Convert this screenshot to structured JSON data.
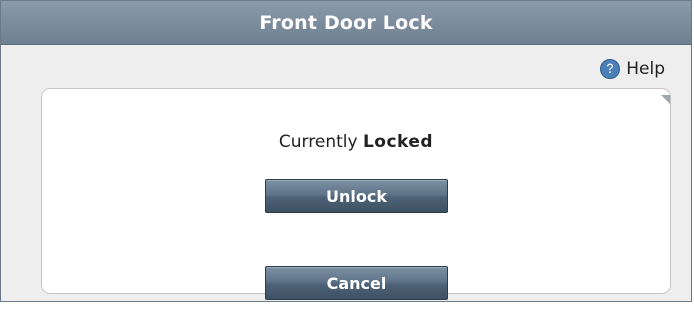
{
  "window": {
    "title": "Front Door Lock"
  },
  "help": {
    "label": "Help",
    "icon": "question-icon"
  },
  "status": {
    "prefix": "Currently",
    "state": "Locked"
  },
  "actions": {
    "unlock_label": "Unlock",
    "cancel_label": "Cancel"
  },
  "colors": {
    "titlebar": "#7a8b9c",
    "button": "#5a6f84",
    "help_icon": "#4a7fb8"
  }
}
